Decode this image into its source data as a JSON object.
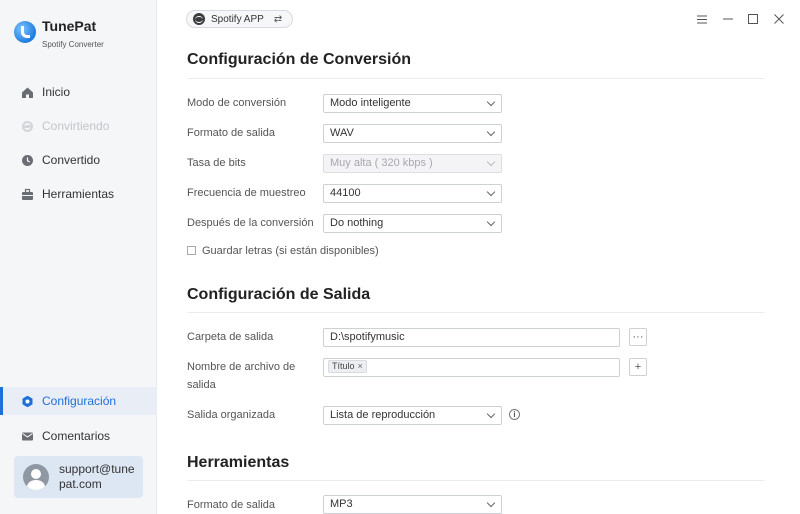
{
  "app": {
    "name": "TunePat",
    "subtitle": "Spotify Converter"
  },
  "sidebar": {
    "items": [
      {
        "label": "Inicio",
        "icon": "home-icon",
        "state": "normal"
      },
      {
        "label": "Convirtiendo",
        "icon": "converting-icon",
        "state": "disabled"
      },
      {
        "label": "Convertido",
        "icon": "clock-icon",
        "state": "normal"
      },
      {
        "label": "Herramientas",
        "icon": "toolbox-icon",
        "state": "normal"
      },
      {
        "label": "Configuración",
        "icon": "settings-icon",
        "state": "active"
      },
      {
        "label": "Comentarios",
        "icon": "mail-icon",
        "state": "normal"
      }
    ],
    "account": {
      "email": "support@tunepat.com"
    }
  },
  "topbar": {
    "source": "Spotify APP",
    "swap_icon": "swap-icon",
    "window_controls": [
      "menu-icon",
      "minimize-icon",
      "maximize-icon",
      "close-icon"
    ]
  },
  "conversion": {
    "title": "Configuración de Conversión",
    "mode_label": "Modo de conversión",
    "mode_value": "Modo inteligente",
    "format_label": "Formato de salida",
    "format_value": "WAV",
    "bitrate_label": "Tasa de bits",
    "bitrate_value": "Muy alta ( 320 kbps )",
    "samplerate_label": "Frecuencia de muestreo",
    "samplerate_value": "44100",
    "after_label": "Después de la conversión",
    "after_value": "Do nothing",
    "lyrics_label": "Guardar letras (si están disponibles)",
    "lyrics_checked": false
  },
  "output": {
    "title": "Configuración de Salida",
    "folder_label": "Carpeta de salida",
    "folder_value": "D:\\spotifymusic",
    "browse_label": "···",
    "filename_label_1": "Nombre de archivo de",
    "filename_label_2": "salida",
    "filename_tag": "Título",
    "tag_remove": "×",
    "add_label": "+",
    "organized_label": "Salida organizada",
    "organized_value": "Lista de reproducción",
    "info": "i"
  },
  "tools": {
    "title": "Herramientas",
    "format_label": "Formato de salida",
    "format_value": "MP3"
  }
}
